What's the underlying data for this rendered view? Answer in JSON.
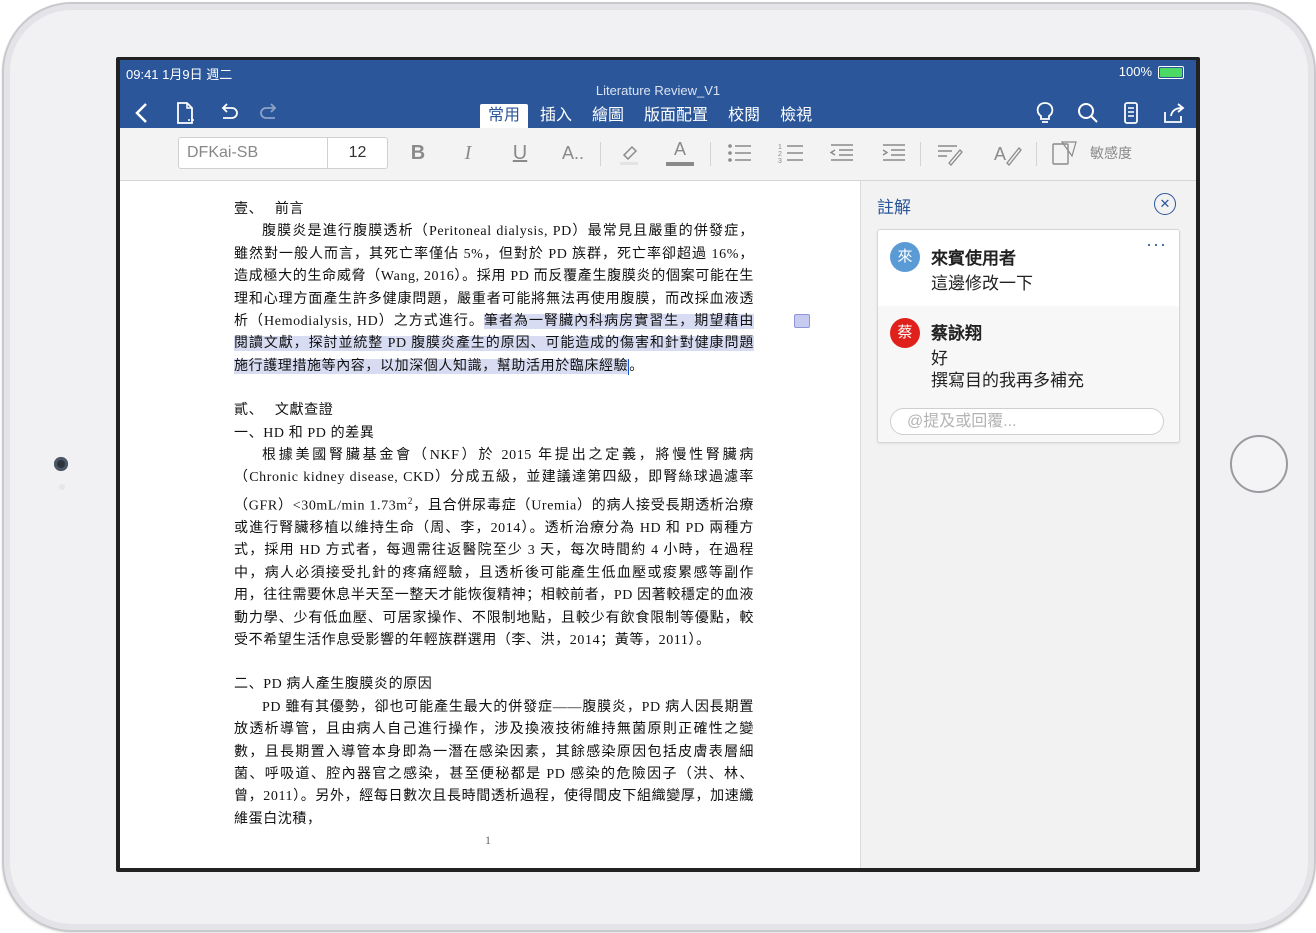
{
  "status": {
    "time": "09:41  1月9日 週二",
    "battery": "100%"
  },
  "document": {
    "title": "Literature Review_V1"
  },
  "toolbar": {
    "tabs": [
      {
        "label": "常用",
        "active": true
      },
      {
        "label": "插入"
      },
      {
        "label": "繪圖"
      },
      {
        "label": "版面配置"
      },
      {
        "label": "校閱"
      },
      {
        "label": "檢視"
      }
    ],
    "icons": [
      "back-icon",
      "file-icon",
      "undo-icon",
      "redo-icon",
      "lightbulb-icon",
      "search-icon",
      "reading-mode-icon",
      "share-icon"
    ]
  },
  "ribbon": {
    "font_name_placeholder": "DFKai-SB",
    "font_size": "12",
    "bold": "B",
    "italic": "I",
    "underline": "U",
    "font_effects": "A..",
    "font_color": "A",
    "sensitivity_label": "敏感度",
    "icons": [
      "highlighter-icon",
      "bullets-icon",
      "numbering-icon",
      "decrease-indent-icon",
      "increase-indent-icon",
      "paragraph-style-icon",
      "styles-icon",
      "sensitivity-icon"
    ]
  },
  "page": {
    "h1": "壹、　 前言",
    "p1_a": "腹膜炎是進行腹膜透析（Peritoneal dialysis, PD）最常見且嚴重的併發症，雖然對一般人而言，其死亡率僅佔 5%，但對於 PD 族群，死亡率卻超過 16%，造成極大的生命威脅（Wang, 2016）。採用 PD 而反覆產生腹膜炎的個案可能在生理和心理方面產生許多健康問題，嚴重者可能將無法再使用腹膜，而改採血液透析（Hemodialysis, HD）之方式進行。",
    "p1_highlight": "筆者為一腎臟內科病房實習生，期望藉由閱讀文獻，探討並統整 PD 腹膜炎產生的原因、可能造成的傷害和針對健康問題施行護理措施等內容，以加深個人知識，幫助活用於臨床經驗",
    "p1_end": "。",
    "h2": "貳、　 文獻查證",
    "h2_sub1": "一、HD 和 PD 的差異",
    "p2_a": "根據美國腎臟基金會（NKF）於 2015 年提出之定義，將慢性腎臟病（Chronic kidney disease, CKD）分成五級，並建議達第四級，即腎絲球過濾率（GFR）<30mL/min 1.73m",
    "p2_sup": "2",
    "p2_b": "，且合併尿毒症（Uremia）的病人接受長期透析治療或進行腎臟移植以維持生命（周、李，2014）。透析治療分為 HD 和 PD 兩種方式，採用 HD 方式者，每週需往返醫院至少 3 天，每次時間約 4 小時，在過程中，病人必須接受扎針的疼痛經驗，且透析後可能產生低血壓或痠累感等副作用，往往需要休息半天至一整天才能恢復精神；相較前者，PD 因著較穩定的血液動力學、少有低血壓、可居家操作、不限制地點，且較少有飲食限制等優點，較受不希望生活作息受影響的年輕族群選用（李、洪，2014；黃等，2011）。",
    "h2_sub2": "二、PD 病人產生腹膜炎的原因",
    "p3": "PD 雖有其優勢，卻也可能產生最大的併發症——腹膜炎，PD 病人因長期置放透析導管，且由病人自己進行操作，涉及換液技術維持無菌原則正確性之變數，且長期置入導管本身即為一潛在感染因素，其餘感染原因包括皮膚表層細菌、呼吸道、腔內器官之感染，甚至便秘都是 PD 感染的危險因子（洪、林、曾，2011）。另外，經每日數次且長時間透析過程，使得間皮下組織變厚，加速纖維蛋白沈積，",
    "page_number": "1"
  },
  "comments": {
    "title": "註解",
    "close": "✕",
    "more": "···",
    "items": [
      {
        "initial": "來",
        "author": "來賓使用者",
        "lines": [
          "這邊修改一下"
        ],
        "color": "#5b9bd5"
      },
      {
        "initial": "蔡",
        "author": "蔡詠翔",
        "lines": [
          "好",
          "撰寫目的我再多補充"
        ],
        "color": "#e0211b"
      }
    ],
    "reply_placeholder": "@提及或回覆..."
  }
}
